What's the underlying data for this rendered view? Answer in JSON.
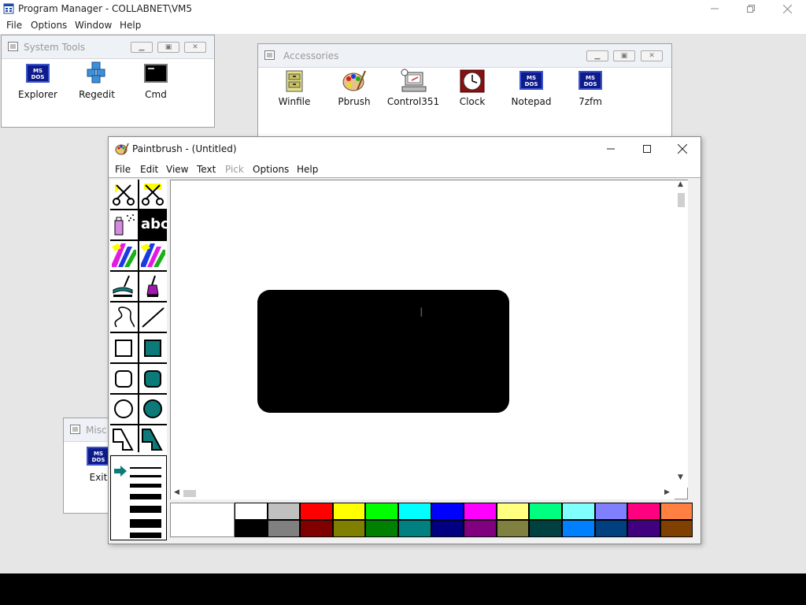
{
  "program_manager": {
    "title": "Program Manager - COLLABNET\\VM5",
    "menu": [
      "File",
      "Options",
      "Window",
      "Help"
    ]
  },
  "groups": {
    "system_tools": {
      "title": "System Tools",
      "items": [
        {
          "label": "Explorer",
          "icon": "msdos-icon"
        },
        {
          "label": "Regedit",
          "icon": "regedit-cubes-icon"
        },
        {
          "label": "Cmd",
          "icon": "cmd-console-icon"
        }
      ]
    },
    "accessories": {
      "title": "Accessories",
      "items": [
        {
          "label": "Winfile",
          "icon": "file-cabinet-icon"
        },
        {
          "label": "Pbrush",
          "icon": "paint-palette-icon"
        },
        {
          "label": "Control351",
          "icon": "control-panel-icon"
        },
        {
          "label": "Clock",
          "icon": "clock-icon"
        },
        {
          "label": "Notepad",
          "icon": "msdos-icon"
        },
        {
          "label": "7zfm",
          "icon": "msdos-icon"
        }
      ]
    },
    "misc": {
      "title": "Misc",
      "items": [
        {
          "label": "Exit",
          "icon": "msdos-icon"
        }
      ]
    }
  },
  "paintbrush": {
    "title": "Paintbrush - (Untitled)",
    "menu": [
      {
        "label": "File",
        "enabled": true
      },
      {
        "label": "Edit",
        "enabled": true
      },
      {
        "label": "View",
        "enabled": true
      },
      {
        "label": "Text",
        "enabled": true
      },
      {
        "label": "Pick",
        "enabled": false
      },
      {
        "label": "Options",
        "enabled": true
      },
      {
        "label": "Help",
        "enabled": true
      }
    ],
    "tools": [
      "scissors-icon",
      "pick-scissors-icon",
      "airbrush-icon",
      "text-icon",
      "color-eraser-icon",
      "eraser-icon",
      "paint-roller-icon",
      "brush-icon",
      "curve-icon",
      "line-icon",
      "box-icon",
      "filled-box-icon",
      "rounded-box-icon",
      "filled-rounded-box-icon",
      "circle-icon",
      "filled-circle-icon",
      "polygon-icon",
      "filled-polygon-icon"
    ],
    "text_tool_glyph": "abc",
    "selected_tool": "text-icon",
    "foreground_color": "#000000",
    "background_color": "#ffffff",
    "palette_top": [
      "#ffffff",
      "#c0c0c0",
      "#ff0000",
      "#ffff00",
      "#00ff00",
      "#00ffff",
      "#0000ff",
      "#ff00ff",
      "#ffff80",
      "#00ff80",
      "#80ffff",
      "#8080ff",
      "#ff0080",
      "#ff8040"
    ],
    "palette_bottom": [
      "#000000",
      "#808080",
      "#800000",
      "#808000",
      "#008000",
      "#008080",
      "#000080",
      "#800080",
      "#808040",
      "#004040",
      "#0080ff",
      "#004080",
      "#400080",
      "#804000"
    ]
  }
}
